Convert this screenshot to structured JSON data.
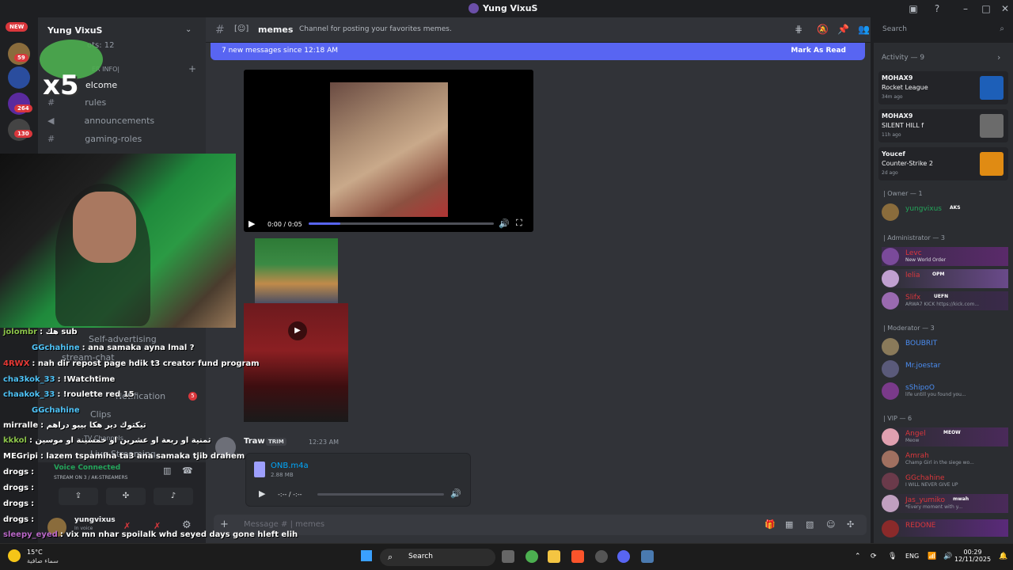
{
  "window": {
    "title": "Yung VixuS"
  },
  "colors": {
    "accent": "#5865f2",
    "online": "#23a55a",
    "danger": "#da373c",
    "link": "#00a8fc"
  },
  "servers": {
    "new_badge": "NEW",
    "badges": [
      "59",
      "264",
      "130"
    ]
  },
  "sidebar": {
    "server_name": "Yung VixuS",
    "boost": "ots: 12",
    "category": "ER INFO|",
    "channels": [
      {
        "icon": "hash-icon",
        "label": "elcome"
      },
      {
        "icon": "hash-icon",
        "label": "rules"
      },
      {
        "icon": "megaphone-icon",
        "label": "announcements"
      },
      {
        "icon": "hash-icon",
        "label": "gaming-roles"
      }
    ],
    "lower_channels": [
      "Self-advertising",
      "stream-chat",
      "Notification",
      "Clips",
      "TV Channels",
      "Live Streaming"
    ],
    "notif_badge": "5",
    "voice": {
      "status": "Voice Connected",
      "detail": "STREAM ON 3 / AK-STREAMERS"
    },
    "user": {
      "name": "yungvixus",
      "status": "In voice"
    }
  },
  "header": {
    "channel": "memes",
    "topic": "Channel for posting your favorites memes.",
    "search_placeholder": "Search"
  },
  "new_messages": {
    "text": "7 new messages since 12:18 AM",
    "action": "Mark As Read"
  },
  "video": {
    "time": "0:00 / 0:05",
    "progress": 0.17
  },
  "message": {
    "author": "Traw",
    "tag": "TRIM",
    "time": "12:23 AM",
    "file_name": "ONB.m4a",
    "file_size": "2.88 MB",
    "audio_time": "-:-- / -:--"
  },
  "composer": {
    "placeholder": "Message # | memes"
  },
  "members": {
    "activity_header": "Activity — 9",
    "activities": [
      {
        "name": "MOHAX9",
        "game": "Rocket League",
        "since": "34m ago",
        "color": "#1d5fb8"
      },
      {
        "name": "MOHAX9",
        "game": "SILENT HILL f",
        "since": "11h ago",
        "color": "#6b6b6b"
      },
      {
        "name": "Youcef",
        "game": "Counter-Strike 2",
        "since": "2d ago",
        "color": "#e08b13"
      }
    ],
    "groups": [
      {
        "header": "| Owner — 1",
        "members": [
          {
            "name": "yungvixus",
            "tag": "AKS",
            "status": "",
            "color": "#23a55a"
          }
        ]
      },
      {
        "header": "| Administrator — 3",
        "members": [
          {
            "name": "Levc",
            "tag": "",
            "status": "New World Order",
            "color": "#da373c"
          },
          {
            "name": "lelia",
            "tag": "OPM",
            "status": "",
            "color": "#da373c"
          },
          {
            "name": "Slifx",
            "tag": "UEFN",
            "status": "ARWA7 KICK https://kick.com...",
            "color": "#da373c"
          }
        ]
      },
      {
        "header": "| Moderator — 3",
        "members": [
          {
            "name": "BOUBRIT",
            "tag": "",
            "status": "",
            "color": "#4a8cf0"
          },
          {
            "name": "Mr.joestar",
            "tag": "",
            "status": "",
            "color": "#4a8cf0"
          },
          {
            "name": "sShipoO",
            "tag": "",
            "status": "life untill you found you...",
            "color": "#4a8cf0"
          }
        ]
      },
      {
        "header": "| VIP — 6",
        "members": [
          {
            "name": "Angel",
            "tag": "MEOW",
            "status": "Meow",
            "color": "#da373c"
          },
          {
            "name": "Amrah",
            "tag": "",
            "status": "Champ Girl in the siege wo...",
            "color": "#da373c"
          },
          {
            "name": "GGchahine",
            "tag": "",
            "status": "I WILL NEVER GIVE UP",
            "color": "#da373c"
          },
          {
            "name": "Jas_yumiko",
            "tag": "mwah",
            "status": "*Every moment with y...",
            "color": "#da373c"
          },
          {
            "name": "REDONE",
            "tag": "",
            "status": "",
            "color": "#da373c"
          }
        ]
      }
    ]
  },
  "overlay_chat": [
    {
      "user": "jolombr",
      "color": "#8bc34a",
      "text": ": هك sub"
    },
    {
      "user": "GGchahine",
      "color": "#4fc3f7",
      "text": ": ana samaka ayna lmal ?"
    },
    {
      "user": "4RWX",
      "color": "#e53935",
      "text": ": nah dir repost page hdik t3 creator fund program"
    },
    {
      "user": "cha3kok_33",
      "color": "#4fc3f7",
      "text": ": !Watchtime"
    },
    {
      "user": "chaakok_33",
      "color": "#4fc3f7",
      "text": ": !roulette red 15"
    },
    {
      "user": "GGchahine",
      "color": "#4fc3f7",
      "text": ""
    },
    {
      "user": "mirralle",
      "color": "#ffffff",
      "text": ": تيكتوك دير هكا بيبو دراهم"
    },
    {
      "user": "kkkol",
      "color": "#8bc34a",
      "text": ": ثمنية او ربعة او عشرين او خمسينة او موسين"
    },
    {
      "user": "MEGripi",
      "color": "#ffffff",
      "text": ": lazem tspamiha ta3 ana samaka tjib drahem"
    },
    {
      "user": "drogs",
      "color": "#ffffff",
      "text": ":"
    },
    {
      "user": "drogs",
      "color": "#ffffff",
      "text": ":"
    },
    {
      "user": "drogs",
      "color": "#ffffff",
      "text": ":"
    },
    {
      "user": "drogs",
      "color": "#ffffff",
      "text": ":"
    },
    {
      "user": "sleepy_eyed",
      "color": "#ba68c8",
      "text": ": vix mn nhar spoilalk whd seyed days gone hleft elih"
    }
  ],
  "overlay": {
    "multiplier": "x5"
  },
  "taskbar": {
    "temp": "15°C",
    "weather": "سماء صافية",
    "search": "Search",
    "lang": "ENG",
    "time": "00:29",
    "date": "12/11/2025"
  }
}
